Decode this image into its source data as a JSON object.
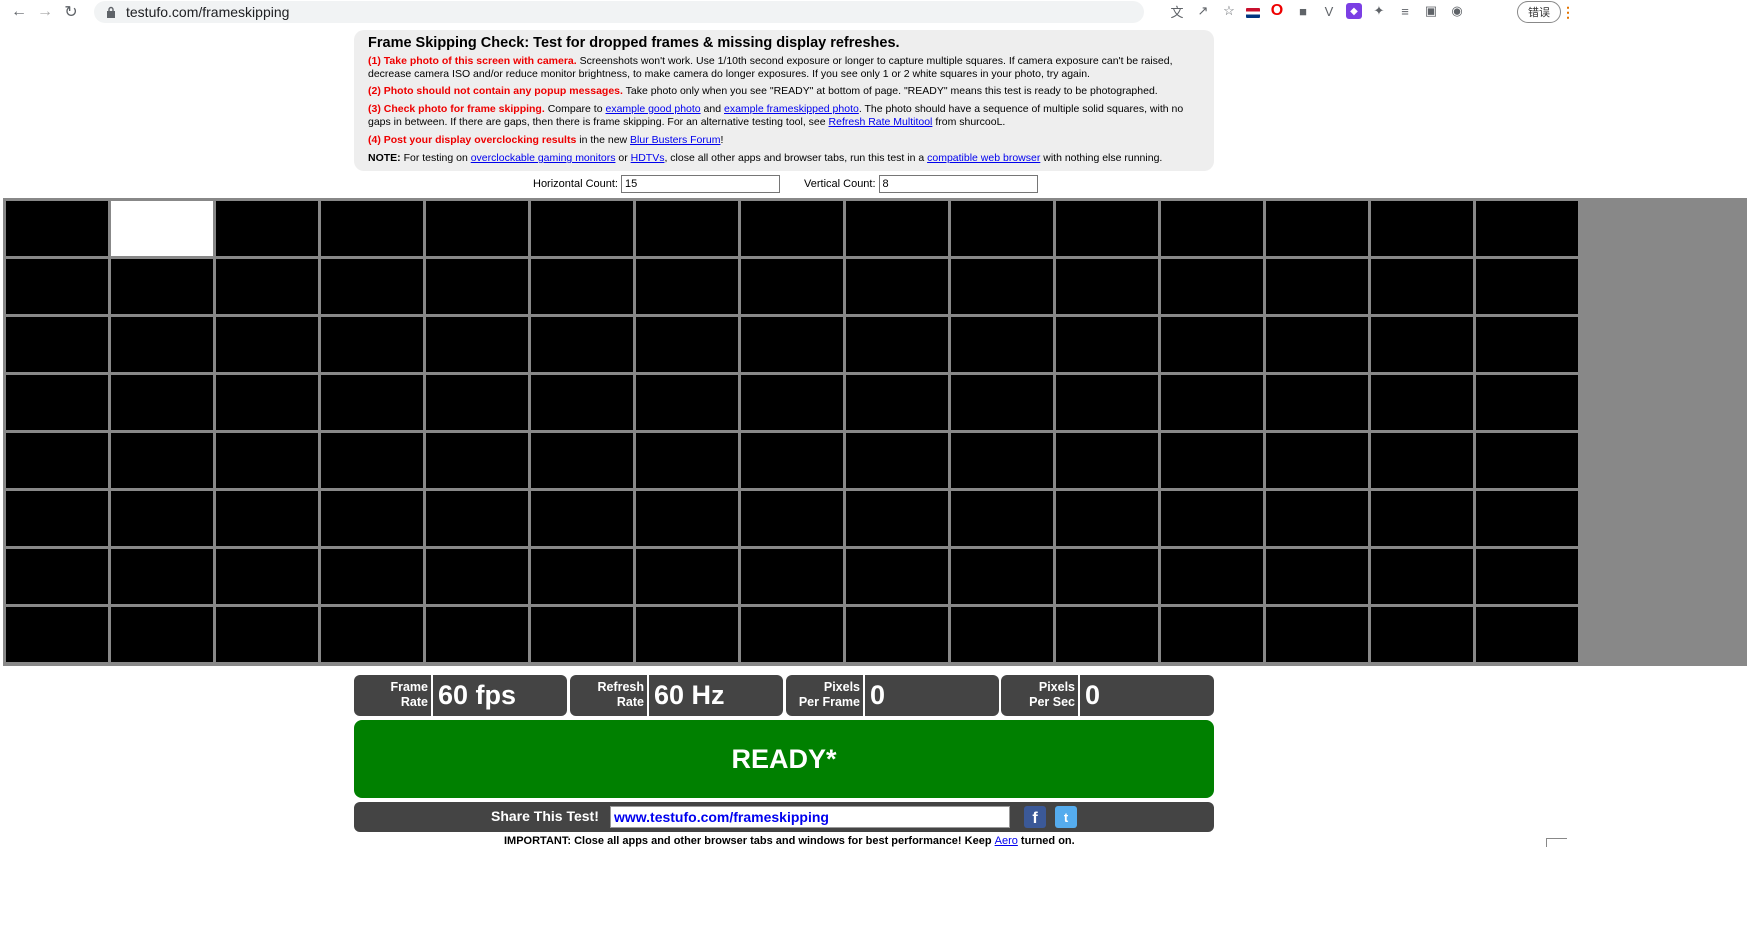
{
  "browser": {
    "url": "testufo.com/frameskipping",
    "profile_label": "错误"
  },
  "info": {
    "title": "Frame Skipping Check: Test for dropped frames & missing display refreshes.",
    "p1_red": "(1) Take photo of this screen with camera.",
    "p1_text": " Screenshots won't work. Use 1/10th second exposure or longer to capture multiple squares. If camera exposure can't be raised, decrease camera ISO and/or reduce monitor brightness, to make camera do longer exposures. If you see only 1 or 2 white squares in your photo, try again.",
    "p2_red": "(2) Photo should not contain any popup messages.",
    "p2_text": " Take photo only when you see \"READY\" at bottom of page. \"READY\" means this test is ready to be photographed.",
    "p3_red": "(3) Check photo for frame skipping.",
    "p3_a": " Compare to ",
    "p3_link1": "example good photo",
    "p3_b": " and ",
    "p3_link2": "example frameskipped photo",
    "p3_c": ". The photo should have a sequence of multiple solid squares, with no gaps in between. If there are gaps, then there is frame skipping. For an alternative testing tool, see ",
    "p3_link3": "Refresh Rate Multitool",
    "p3_d": " from shurcooL.",
    "p4_red": "(4) Post your display overclocking results",
    "p4_a": " in the new ",
    "p4_link": "Blur Busters Forum",
    "p4_b": "!",
    "note_label": "NOTE:",
    "note_a": " For testing on ",
    "note_link1": "overclockable gaming monitors",
    "note_b": " or ",
    "note_link2": "HDTVs",
    "note_c": ", close all other apps and browser tabs, run this test in a ",
    "note_link3": "compatible web browser",
    "note_d": " with nothing else running."
  },
  "counts": {
    "horizontal_label": "Horizontal Count:",
    "horizontal_value": "15",
    "vertical_label": "Vertical Count:",
    "vertical_value": "8"
  },
  "grid": {
    "columns": 15,
    "rows": 8,
    "lit_cells": [
      [
        0,
        1
      ]
    ]
  },
  "stats": [
    {
      "label_line1": "Frame",
      "label_line2": "Rate",
      "value": "60 fps"
    },
    {
      "label_line1": "Refresh",
      "label_line2": "Rate",
      "value": "60 Hz"
    },
    {
      "label_line1": "Pixels",
      "label_line2": "Per Frame",
      "value": "0"
    },
    {
      "label_line1": "Pixels",
      "label_line2": "Per Sec",
      "value": "0"
    }
  ],
  "status": "READY*",
  "share": {
    "label": "Share This Test!",
    "url": "www.testufo.com/frameskipping",
    "facebook": "f",
    "twitter": "t"
  },
  "important": {
    "text_a": "IMPORTANT: Close all apps and other browser tabs and windows for best performance! Keep ",
    "link": "Aero",
    "text_b": " turned on."
  },
  "colors": {
    "ready_bg": "#008000",
    "stat_bg": "#444444",
    "red_text": "#ee0000",
    "link": "#0000ee"
  }
}
